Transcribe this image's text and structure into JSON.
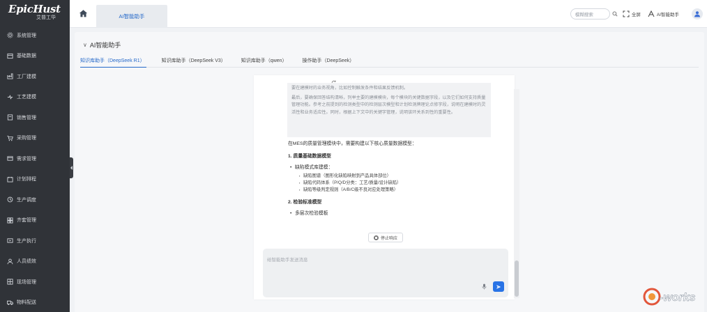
{
  "app": {
    "brand": "EpicHust",
    "brand_sub": "艾普工华"
  },
  "sidebar": {
    "items": [
      {
        "label": "系统管理",
        "icon": "gear-icon"
      },
      {
        "label": "基础数据",
        "icon": "database-icon"
      },
      {
        "label": "工厂建模",
        "icon": "factory-icon"
      },
      {
        "label": "工艺建模",
        "icon": "process-icon"
      },
      {
        "label": "销售管理",
        "icon": "sales-icon"
      },
      {
        "label": "采购管理",
        "icon": "cart-icon"
      },
      {
        "label": "需求管理",
        "icon": "demand-icon"
      },
      {
        "label": "计划排程",
        "icon": "calendar-icon"
      },
      {
        "label": "生产调度",
        "icon": "dispatch-icon"
      },
      {
        "label": "齐套管理",
        "icon": "kit-icon"
      },
      {
        "label": "生产执行",
        "icon": "execute-icon"
      },
      {
        "label": "人员绩效",
        "icon": "user-icon"
      },
      {
        "label": "现场管理",
        "icon": "site-icon"
      },
      {
        "label": "物料配送",
        "icon": "truck-icon"
      }
    ]
  },
  "topbar": {
    "tab_label": "AI智能助手",
    "search_placeholder": "模糊搜索",
    "fullscreen_label": "全屏",
    "ai_assistant_label": "AI智能助手"
  },
  "page": {
    "title": "AI智能助手",
    "tabs": [
      {
        "label": "知识库助手（DeepSeek R1）",
        "active": true
      },
      {
        "label": "知识库助手（DeepSeek V3）",
        "active": false
      },
      {
        "label": "知识库助手（qwen）",
        "active": false
      },
      {
        "label": "操作助手（DeepSeek）",
        "active": false
      }
    ]
  },
  "chat": {
    "thinking_paragraphs": [
      "要在建模时的业务视角，比如控制触发条件和结果反馈机制。",
      "最后，要确保回答结构清晰，列举主要的建模模块，每个模块的关键数据字段，以及它们如何支持质量管理功能。参考之前提到的检测类型中的检测层次模型和计划检测牌理论点修字段，说明在建模时的灵活性和业务适应性。同时，根据上下文中的关键字管理，说明该环关系到性的重要性。"
    ],
    "answer_intro": "在MES的质量管理模块中，需要构建以下核心质量数据模型：",
    "section1_title": "1. 质量基础数据模型",
    "section1_item": "缺陷模式库建模：",
    "section1_subitems": [
      "缺陷图谱（图形化缺陷映射到产品具体部位）",
      "缺陷代码体系（P/Q/D分类：工艺/质量/设计缺陷）",
      "缺陷等级判定规则（A/B/C级不良对应处理策略）"
    ],
    "section2_title": "2. 检验标准模型",
    "section2_item": "多层次检验模板",
    "stop_label": "停止响应",
    "input_placeholder": "给智能助手发送消息"
  },
  "colors": {
    "sidebar_bg": "#303338",
    "accent": "#2468c9",
    "send_button": "#2873e6"
  }
}
